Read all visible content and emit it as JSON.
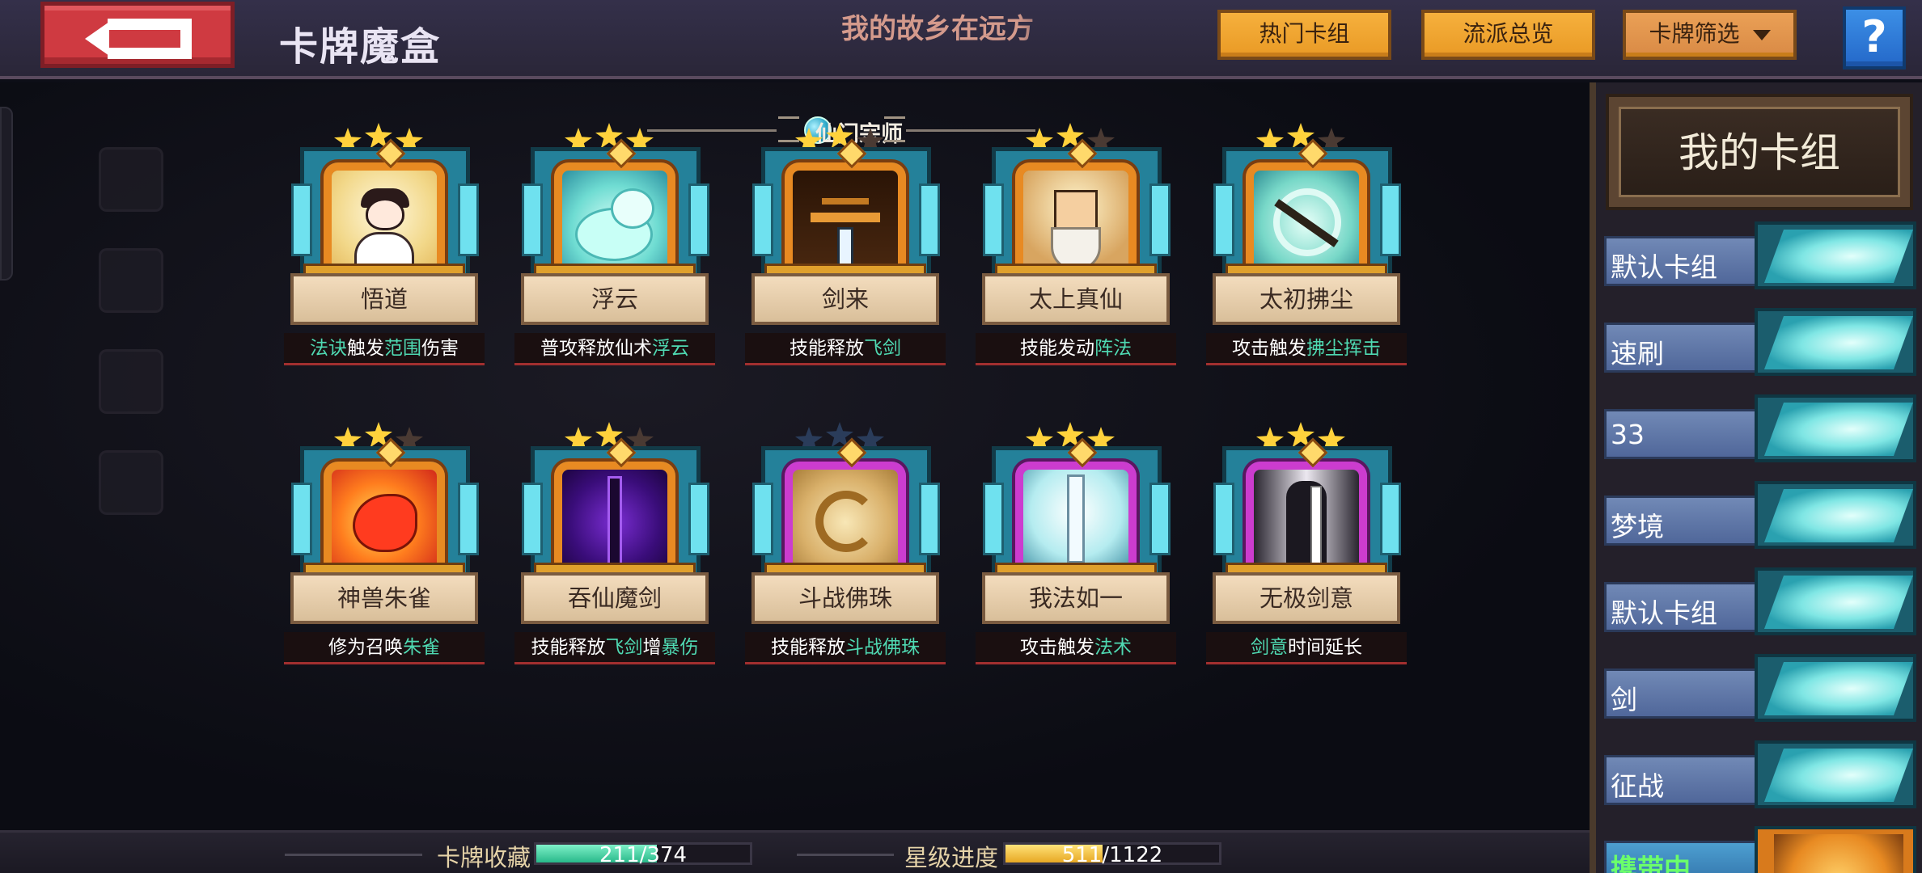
{
  "header": {
    "title": "卡牌魔盒",
    "marquee_text": "我的故乡在远方",
    "buttons": {
      "hot_decks": "热门卡组",
      "school_overview": "流派总览",
      "card_filter": "卡牌筛选"
    },
    "help_label": "?"
  },
  "section": {
    "name": "仙门宗师"
  },
  "cards": [
    {
      "name": "悟道",
      "stars": 3,
      "desc": [
        {
          "t": "法诀",
          "h": true
        },
        {
          "t": "触发",
          "h": false
        },
        {
          "t": "范围",
          "h": true
        },
        {
          "t": "伤害",
          "h": false
        }
      ],
      "art": "wudao"
    },
    {
      "name": "浮云",
      "stars": 3,
      "desc": [
        {
          "t": "普攻释放仙术",
          "h": false
        },
        {
          "t": "浮云",
          "h": true
        }
      ],
      "art": "fuyun"
    },
    {
      "name": "剑来",
      "stars": 2,
      "desc": [
        {
          "t": "技能释放",
          "h": false
        },
        {
          "t": "飞剑",
          "h": true
        }
      ],
      "art": "jianlai"
    },
    {
      "name": "太上真仙",
      "stars": 2,
      "desc": [
        {
          "t": "技能发动",
          "h": false
        },
        {
          "t": "阵法",
          "h": true
        }
      ],
      "art": "taishang"
    },
    {
      "name": "太初拂尘",
      "stars": 2,
      "desc": [
        {
          "t": "攻击触发",
          "h": false
        },
        {
          "t": "拂尘挥击",
          "h": true
        }
      ],
      "art": "fuchen"
    },
    {
      "name": "神兽朱雀",
      "stars": 2,
      "desc": [
        {
          "t": "修为召唤",
          "h": false
        },
        {
          "t": "朱雀",
          "h": true
        }
      ],
      "art": "zhuque"
    },
    {
      "name": "吞仙魔剑",
      "stars": 2,
      "desc": [
        {
          "t": "技能释放",
          "h": false
        },
        {
          "t": "飞剑",
          "h": true
        },
        {
          "t": "增",
          "h": false
        },
        {
          "t": "暴伤",
          "h": true
        }
      ],
      "art": "tunxian"
    },
    {
      "name": "斗战佛珠",
      "stars": 0,
      "desc": [
        {
          "t": "技能释放",
          "h": false
        },
        {
          "t": "斗战佛珠",
          "h": true
        }
      ],
      "art": "fozhu"
    },
    {
      "name": "我法如一",
      "stars": 3,
      "desc": [
        {
          "t": "攻击触发",
          "h": false
        },
        {
          "t": "法术",
          "h": true
        }
      ],
      "art": "rouyi"
    },
    {
      "name": "无极剑意",
      "stars": 3,
      "desc": [
        {
          "t": "剑意",
          "h": true
        },
        {
          "t": "时间延长",
          "h": false
        }
      ],
      "art": "wuji"
    }
  ],
  "bottom": {
    "collection_label": "卡牌收藏",
    "collection_value": "211/374",
    "collection_fraction": 0.564,
    "star_label": "星级进度",
    "star_value": "511/1122",
    "star_fraction": 0.455
  },
  "deck_panel": {
    "title": "我的卡组",
    "decks": [
      "默认卡组",
      "速刷",
      "33",
      "梦境",
      "默认卡组",
      "剑",
      "征战"
    ],
    "carrying_label": "携带中"
  },
  "colors": {
    "highlight": "#4fd9b2",
    "top_button": "#f6b03d",
    "back_button": "#cf3a41",
    "star_on": "#ffd23c"
  }
}
